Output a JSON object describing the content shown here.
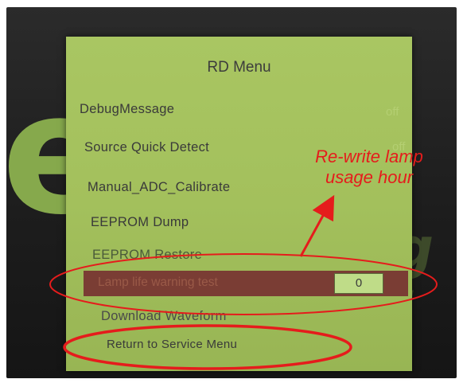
{
  "background": {
    "glyph": "e",
    "text": "g i"
  },
  "menu": {
    "title": "RD Menu",
    "items": [
      {
        "label": "DebugMessage"
      },
      {
        "label": "Source Quick Detect"
      },
      {
        "label": "Manual_ADC_Calibrate"
      },
      {
        "label": "EEPROM Dump"
      },
      {
        "label": "EEPROM Restore"
      },
      {
        "label": "Lamp life warning test",
        "value": "0",
        "selected": true
      },
      {
        "label": "Download Waveform"
      },
      {
        "label": "Return to Service Menu"
      }
    ],
    "faint_values": [
      "off",
      "off"
    ]
  },
  "annotation": {
    "text": "Re-write lamp usage hour",
    "color": "#e51c1c"
  },
  "colors": {
    "menu_bg": "#a9c662",
    "highlight_row": "#7a3d34",
    "annotation_red": "#e51c1c"
  }
}
